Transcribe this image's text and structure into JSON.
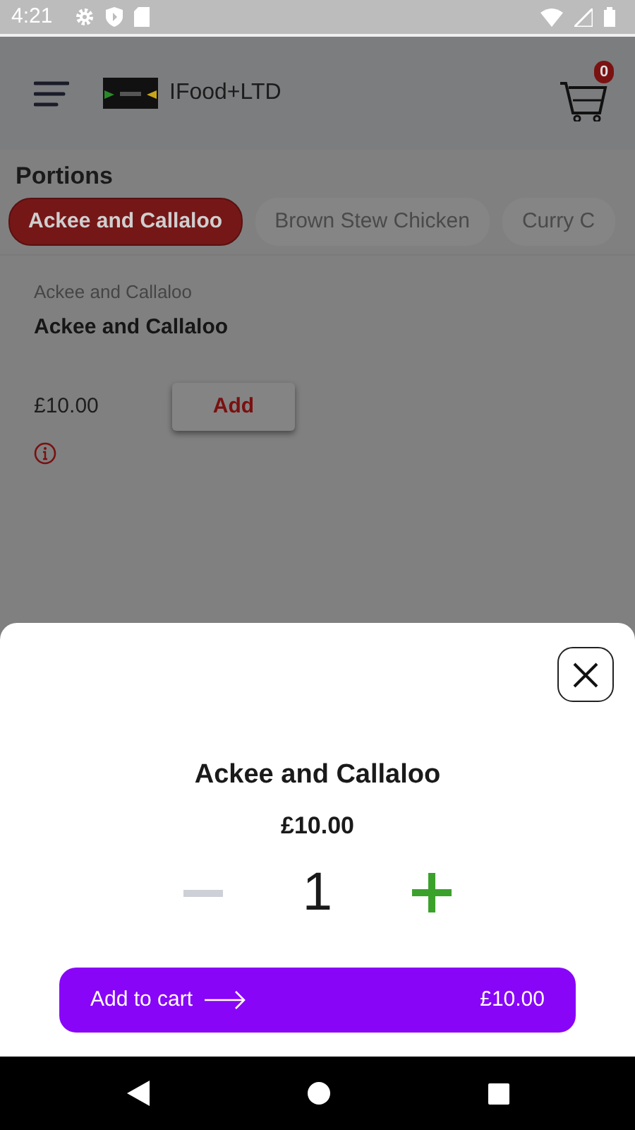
{
  "status_bar": {
    "time": "4:21"
  },
  "app_bar": {
    "title": "IFood+LTD",
    "cart_count": "0"
  },
  "portions": {
    "heading": "Portions",
    "tabs": [
      {
        "label": "Ackee and Callaloo",
        "selected": true
      },
      {
        "label": "Brown Stew Chicken",
        "selected": false
      },
      {
        "label": "Curry C",
        "selected": false
      }
    ]
  },
  "item": {
    "category": "Ackee and Callaloo",
    "name": "Ackee and Callaloo",
    "price": "£10.00",
    "add_button": "Add"
  },
  "sheet": {
    "title": "Ackee and Callaloo",
    "price": "£10.00",
    "quantity": "1",
    "minus_disabled": true,
    "cart_button": {
      "label": "Add to cart",
      "total": "£10.00"
    }
  }
}
